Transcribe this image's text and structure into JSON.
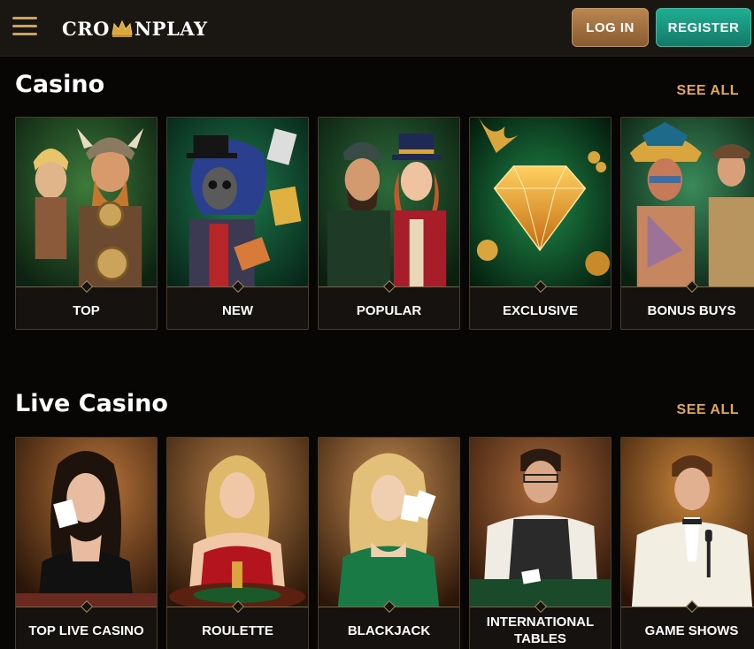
{
  "header": {
    "logo_left": "CRO",
    "logo_right": "NPLAY",
    "login_label": "LOG IN",
    "register_label": "REGISTER"
  },
  "casino": {
    "title": "Casino",
    "see_all": "SEE ALL",
    "cards": [
      {
        "label": "TOP"
      },
      {
        "label": "NEW"
      },
      {
        "label": "POPULAR"
      },
      {
        "label": "EXCLUSIVE"
      },
      {
        "label": "BONUS BUYS"
      }
    ]
  },
  "live": {
    "title": "Live Casino",
    "see_all": "SEE ALL",
    "cards": [
      {
        "label": "TOP LIVE CASINO"
      },
      {
        "label": "ROULETTE"
      },
      {
        "label": "BLACKJACK"
      },
      {
        "label": "INTERNATIONAL TABLES"
      },
      {
        "label": "GAME SHOWS"
      }
    ]
  },
  "colors": {
    "accent_gold": "#e0a85a",
    "login_bg": "#a87444",
    "register_bg": "#1a9a82",
    "background": "#070605"
  },
  "icons": [
    "hamburger-menu-icon",
    "crown-icon"
  ]
}
